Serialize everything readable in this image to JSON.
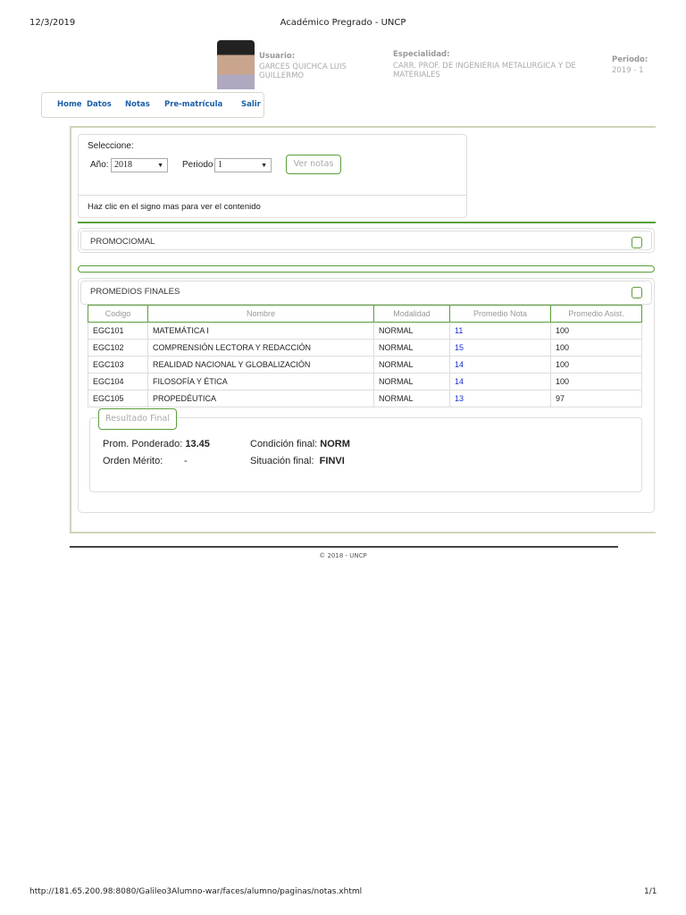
{
  "print_header": {
    "date": "12/3/2019",
    "title": "Académico Pregrado - UNCP"
  },
  "user": {
    "usuario_label": "Usuario:",
    "usuario_line1": "GARCES QUICHCA LUIS",
    "usuario_line2": "GUILLERMO",
    "especialidad_label": "Especialidad:",
    "especialidad_line1": "CARR. PROF. DE INGENIERIA METALURGICA Y DE",
    "especialidad_line2": "MATERIALES",
    "periodo_label": "Periodo:",
    "periodo_value": "2019 - 1"
  },
  "nav": [
    "Home",
    "Datos",
    "Notas",
    "Pre-matrícula",
    "Salir"
  ],
  "selector": {
    "title": "Seleccione:",
    "anio_label": "Año:",
    "anio_value": "2018",
    "periodo_label": "Periodo",
    "periodo_value": "1",
    "button": "Ver notas",
    "hint": "Haz clic en el signo mas para ver el contenido"
  },
  "panels": {
    "promocional": "PROMOCIOMAL",
    "promedios": "PROMEDIOS FINALES"
  },
  "table": {
    "headers": [
      "Codigo",
      "Nombre",
      "Modalidad",
      "Promedio Nota",
      "Promedio Asist."
    ],
    "rows": [
      [
        "EGC101",
        "MATEMÁTICA I",
        "NORMAL",
        "11",
        "100"
      ],
      [
        "EGC102",
        "COMPRENSIÓN LECTORA Y REDACCIÓN",
        "NORMAL",
        "15",
        "100"
      ],
      [
        "EGC103",
        "REALIDAD NACIONAL Y GLOBALIZACIÓN",
        "NORMAL",
        "14",
        "100"
      ],
      [
        "EGC104",
        "FILOSOFÍA Y ÉTICA",
        "NORMAL",
        "14",
        "100"
      ],
      [
        "EGC105",
        "PROPEDÉUTICA",
        "NORMAL",
        "13",
        "97"
      ]
    ]
  },
  "resultado": {
    "legend": "Resultado Final",
    "prom_label": "Prom. Ponderado:",
    "prom_value": "13.45",
    "orden_label": "Orden Mérito:",
    "orden_value": "-",
    "condicion_label": "Condición final:",
    "condicion_value": "NORM",
    "situacion_label": "Situación final:",
    "situacion_value": "FINVI"
  },
  "footer": "© 2018 - UNCP",
  "print_footer": {
    "url": "http://181.65.200.98:8080/Galileo3Alumno-war/faces/alumno/paginas/notas.xhtml",
    "page": "1/1"
  }
}
